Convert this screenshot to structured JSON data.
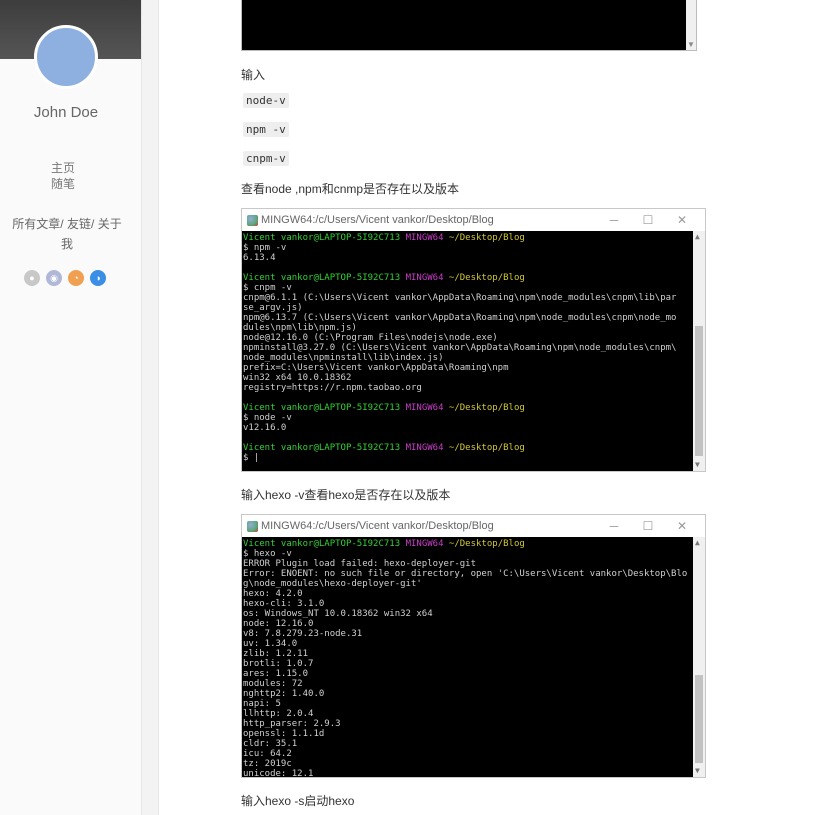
{
  "sidebar": {
    "author": "John Doe",
    "nav_main": [
      "主页",
      "随笔"
    ],
    "nav_links": {
      "all_posts": "所有文章",
      "friends": "友链",
      "about": "关于我",
      "separator": "/"
    },
    "social_icons": [
      "github-icon",
      "weibo-icon",
      "rss-icon",
      "zhihu-icon"
    ]
  },
  "content": {
    "p_input": "输入",
    "code_node": "node-v",
    "code_npm": "npm -v",
    "code_cnpm": "cnpm-v",
    "p_check": "查看node ,npm和cnmp是否存在以及版本",
    "p_hexo_v": "输入hexo -v查看hexo是否存在以及版本",
    "p_hexo_s": "输入hexo -s启动hexo"
  },
  "terminal1": {
    "title": "MINGW64:/c/Users/Vicent vankor/Desktop/Blog",
    "prompt_user": "Vicent vankor@LAPTOP-5I92C713",
    "prompt_shell": "MINGW64",
    "prompt_path": "~/Desktop/Blog",
    "cmd1": "$ npm -v",
    "out1": "6.13.4",
    "cmd2": "$ cnpm -v",
    "out2": "cnpm@6.1.1 (C:\\Users\\Vicent vankor\\AppData\\Roaming\\npm\\node_modules\\cnpm\\lib\\par\nse_argv.js)\nnpm@6.13.7 (C:\\Users\\Vicent vankor\\AppData\\Roaming\\npm\\node_modules\\cnpm\\node_mo\ndules\\npm\\lib\\npm.js)\nnode@12.16.0 (C:\\Program Files\\nodejs\\node.exe)\nnpminstall@3.27.0 (C:\\Users\\Vicent vankor\\AppData\\Roaming\\npm\\node_modules\\cnpm\\\nnode_modules\\npminstall\\lib\\index.js)\nprefix=C:\\Users\\Vicent vankor\\AppData\\Roaming\\npm\nwin32 x64 10.0.18362\nregistry=https://r.npm.taobao.org",
    "cmd3": "$ node -v",
    "out3": "v12.16.0",
    "cmd4": "$ |"
  },
  "terminal2": {
    "title": "MINGW64:/c/Users/Vicent vankor/Desktop/Blog",
    "prompt_user": "Vicent vankor@LAPTOP-5I92C713",
    "prompt_shell": "MINGW64",
    "prompt_path": "~/Desktop/Blog",
    "cmd": "$ hexo -v",
    "out": "ERROR Plugin load failed: hexo-deployer-git\nError: ENOENT: no such file or directory, open 'C:\\Users\\Vicent vankor\\Desktop\\Blo\ng\\node_modules\\hexo-deployer-git'\nhexo: 4.2.0\nhexo-cli: 3.1.0\nos: Windows_NT 10.0.18362 win32 x64\nnode: 12.16.0\nv8: 7.8.279.23-node.31\nuv: 1.34.0\nzlib: 1.2.11\nbrotli: 1.0.7\nares: 1.15.0\nmodules: 72\nnghttp2: 1.40.0\nnapi: 5\nllhttp: 2.0.4\nhttp_parser: 2.9.3\nopenssl: 1.1.1d\ncldr: 35.1\nicu: 64.2\ntz: 2019c\nunicode: 12.1"
  },
  "window_buttons": {
    "minimize": "─",
    "maximize": "☐",
    "close": "✕"
  }
}
